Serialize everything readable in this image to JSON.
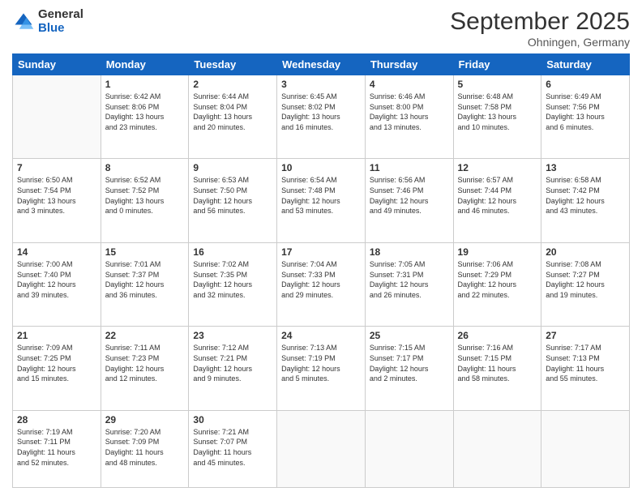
{
  "logo": {
    "general": "General",
    "blue": "Blue"
  },
  "title": "September 2025",
  "subtitle": "Ohningen, Germany",
  "days_header": [
    "Sunday",
    "Monday",
    "Tuesday",
    "Wednesday",
    "Thursday",
    "Friday",
    "Saturday"
  ],
  "weeks": [
    [
      {
        "day": "",
        "info": ""
      },
      {
        "day": "1",
        "info": "Sunrise: 6:42 AM\nSunset: 8:06 PM\nDaylight: 13 hours\nand 23 minutes."
      },
      {
        "day": "2",
        "info": "Sunrise: 6:44 AM\nSunset: 8:04 PM\nDaylight: 13 hours\nand 20 minutes."
      },
      {
        "day": "3",
        "info": "Sunrise: 6:45 AM\nSunset: 8:02 PM\nDaylight: 13 hours\nand 16 minutes."
      },
      {
        "day": "4",
        "info": "Sunrise: 6:46 AM\nSunset: 8:00 PM\nDaylight: 13 hours\nand 13 minutes."
      },
      {
        "day": "5",
        "info": "Sunrise: 6:48 AM\nSunset: 7:58 PM\nDaylight: 13 hours\nand 10 minutes."
      },
      {
        "day": "6",
        "info": "Sunrise: 6:49 AM\nSunset: 7:56 PM\nDaylight: 13 hours\nand 6 minutes."
      }
    ],
    [
      {
        "day": "7",
        "info": "Sunrise: 6:50 AM\nSunset: 7:54 PM\nDaylight: 13 hours\nand 3 minutes."
      },
      {
        "day": "8",
        "info": "Sunrise: 6:52 AM\nSunset: 7:52 PM\nDaylight: 13 hours\nand 0 minutes."
      },
      {
        "day": "9",
        "info": "Sunrise: 6:53 AM\nSunset: 7:50 PM\nDaylight: 12 hours\nand 56 minutes."
      },
      {
        "day": "10",
        "info": "Sunrise: 6:54 AM\nSunset: 7:48 PM\nDaylight: 12 hours\nand 53 minutes."
      },
      {
        "day": "11",
        "info": "Sunrise: 6:56 AM\nSunset: 7:46 PM\nDaylight: 12 hours\nand 49 minutes."
      },
      {
        "day": "12",
        "info": "Sunrise: 6:57 AM\nSunset: 7:44 PM\nDaylight: 12 hours\nand 46 minutes."
      },
      {
        "day": "13",
        "info": "Sunrise: 6:58 AM\nSunset: 7:42 PM\nDaylight: 12 hours\nand 43 minutes."
      }
    ],
    [
      {
        "day": "14",
        "info": "Sunrise: 7:00 AM\nSunset: 7:40 PM\nDaylight: 12 hours\nand 39 minutes."
      },
      {
        "day": "15",
        "info": "Sunrise: 7:01 AM\nSunset: 7:37 PM\nDaylight: 12 hours\nand 36 minutes."
      },
      {
        "day": "16",
        "info": "Sunrise: 7:02 AM\nSunset: 7:35 PM\nDaylight: 12 hours\nand 32 minutes."
      },
      {
        "day": "17",
        "info": "Sunrise: 7:04 AM\nSunset: 7:33 PM\nDaylight: 12 hours\nand 29 minutes."
      },
      {
        "day": "18",
        "info": "Sunrise: 7:05 AM\nSunset: 7:31 PM\nDaylight: 12 hours\nand 26 minutes."
      },
      {
        "day": "19",
        "info": "Sunrise: 7:06 AM\nSunset: 7:29 PM\nDaylight: 12 hours\nand 22 minutes."
      },
      {
        "day": "20",
        "info": "Sunrise: 7:08 AM\nSunset: 7:27 PM\nDaylight: 12 hours\nand 19 minutes."
      }
    ],
    [
      {
        "day": "21",
        "info": "Sunrise: 7:09 AM\nSunset: 7:25 PM\nDaylight: 12 hours\nand 15 minutes."
      },
      {
        "day": "22",
        "info": "Sunrise: 7:11 AM\nSunset: 7:23 PM\nDaylight: 12 hours\nand 12 minutes."
      },
      {
        "day": "23",
        "info": "Sunrise: 7:12 AM\nSunset: 7:21 PM\nDaylight: 12 hours\nand 9 minutes."
      },
      {
        "day": "24",
        "info": "Sunrise: 7:13 AM\nSunset: 7:19 PM\nDaylight: 12 hours\nand 5 minutes."
      },
      {
        "day": "25",
        "info": "Sunrise: 7:15 AM\nSunset: 7:17 PM\nDaylight: 12 hours\nand 2 minutes."
      },
      {
        "day": "26",
        "info": "Sunrise: 7:16 AM\nSunset: 7:15 PM\nDaylight: 11 hours\nand 58 minutes."
      },
      {
        "day": "27",
        "info": "Sunrise: 7:17 AM\nSunset: 7:13 PM\nDaylight: 11 hours\nand 55 minutes."
      }
    ],
    [
      {
        "day": "28",
        "info": "Sunrise: 7:19 AM\nSunset: 7:11 PM\nDaylight: 11 hours\nand 52 minutes."
      },
      {
        "day": "29",
        "info": "Sunrise: 7:20 AM\nSunset: 7:09 PM\nDaylight: 11 hours\nand 48 minutes."
      },
      {
        "day": "30",
        "info": "Sunrise: 7:21 AM\nSunset: 7:07 PM\nDaylight: 11 hours\nand 45 minutes."
      },
      {
        "day": "",
        "info": ""
      },
      {
        "day": "",
        "info": ""
      },
      {
        "day": "",
        "info": ""
      },
      {
        "day": "",
        "info": ""
      }
    ]
  ]
}
